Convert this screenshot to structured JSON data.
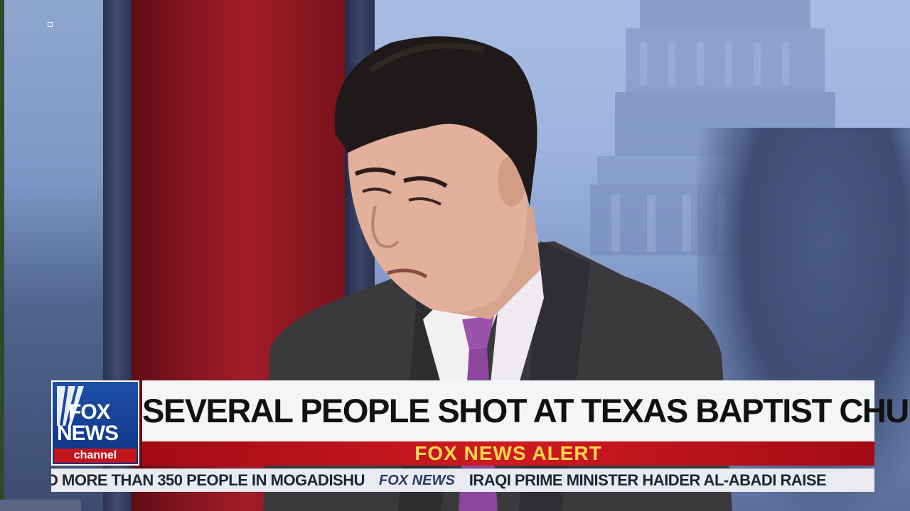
{
  "broadcast": {
    "network_logo": {
      "line1": "FOX",
      "line2": "NEWS",
      "line3": "channel"
    },
    "headline": "SEVERAL PEOPLE SHOT AT TEXAS BAPTIST CHURCH",
    "alert": "FOX NEWS ALERT",
    "ticker": {
      "items": [
        "D MORE THAN 350 PEOPLE IN MOGADISHU",
        "IRAQI PRIME MINISTER HAIDER AL-ABADI RAISE"
      ],
      "separator": "FOX NEWS"
    }
  },
  "colors": {
    "brand_blue": "#1d4fa8",
    "alert_red": "#c2161f",
    "alert_text": "#ffd84a",
    "headline_bg": "#f4f5f7"
  }
}
